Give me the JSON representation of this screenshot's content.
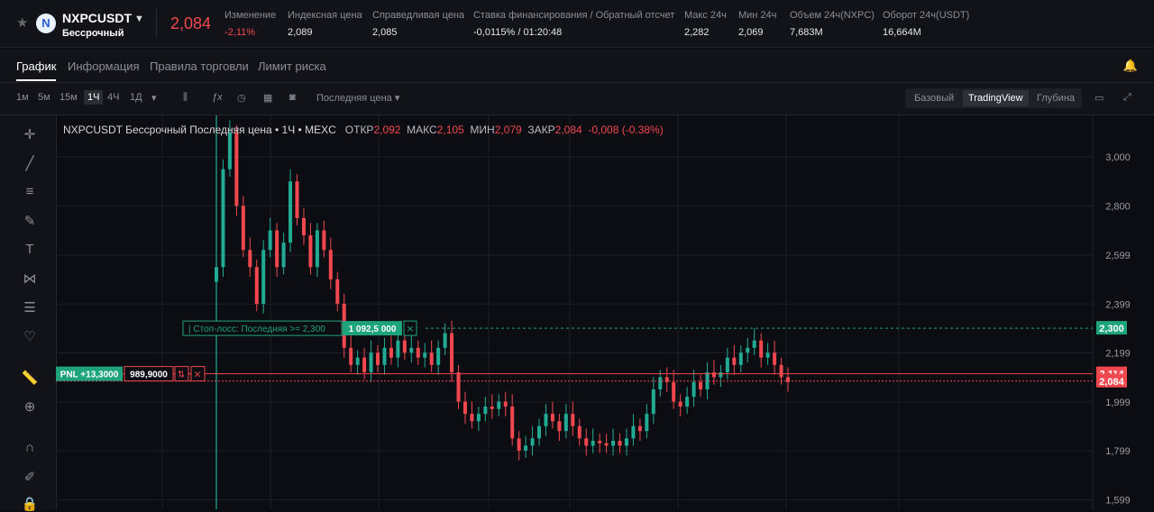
{
  "header": {
    "symbol": "NXPCUSDT",
    "contract": "Бессрочный",
    "last_price": "2,084",
    "stats": [
      {
        "label": "Изменение",
        "value": "-2,11%",
        "red": true
      },
      {
        "label": "Индексная цена",
        "value": "2,089"
      },
      {
        "label": "Справедливая цена",
        "value": "2,085"
      },
      {
        "label": "Ставка финансирования / Обратный отсчет",
        "value": "-0,0115% / 01:20:48"
      },
      {
        "label": "Макс 24ч",
        "value": "2,282"
      },
      {
        "label": "Мин 24ч",
        "value": "2,069"
      },
      {
        "label": "Объем 24ч(NXPC)",
        "value": "7,683M"
      },
      {
        "label": "Оборот 24ч(USDT)",
        "value": "16,664M"
      }
    ]
  },
  "tabs": [
    "График",
    "Информация",
    "Правила торговли",
    "Лимит риска"
  ],
  "toolbar": {
    "intervals": [
      "1м",
      "5м",
      "15м",
      "1Ч",
      "4Ч",
      "1Д"
    ],
    "active_interval": "1Ч",
    "price_source": "Последняя цена",
    "views": [
      "Базовый",
      "TradingView",
      "Глубина"
    ],
    "active_view": "TradingView"
  },
  "legend": {
    "title": "NXPCUSDT Бессрочный Последняя цена • 1Ч • MEXC",
    "open_label": "ОТКР",
    "open": "2,092",
    "high_label": "МАКС",
    "high": "2,105",
    "low_label": "МИН",
    "low": "2,079",
    "close_label": "ЗАКР",
    "close": "2,084",
    "change": "-0,008 (-0.38%)"
  },
  "orders": {
    "stop_loss_label": "Стоп-лосс: Последняя >= 2,300",
    "stop_loss_qty": "1 092,5 000",
    "pnl_label": "PNL +13,3000",
    "position_qty": "989,9000"
  },
  "colors": {
    "up": "#22ab94",
    "down": "#f0484e",
    "bg": "#0c0d12",
    "green_tag": "#1fa37c"
  },
  "chart_data": {
    "type": "candlestick",
    "y_ticks": [
      "3,000",
      "2,800",
      "2,599",
      "2,399",
      "2,199",
      "1,999",
      "1,799",
      "1,599"
    ],
    "ylim": [
      1.56,
      3.17
    ],
    "markers": [
      {
        "label": "2,300",
        "value": 2.3,
        "color": "green"
      },
      {
        "label": "2,114",
        "value": 2.114,
        "color": "red"
      },
      {
        "label": "2,084",
        "value": 2.084,
        "color": "red"
      }
    ],
    "series_close": [
      2.55,
      2.95,
      3.1,
      2.8,
      2.62,
      2.55,
      2.4,
      2.62,
      2.7,
      2.55,
      2.65,
      2.9,
      2.75,
      2.68,
      2.55,
      2.7,
      2.62,
      2.5,
      2.4,
      2.22,
      2.15,
      2.18,
      2.12,
      2.2,
      2.15,
      2.22,
      2.18,
      2.25,
      2.2,
      2.22,
      2.18,
      2.2,
      2.15,
      2.22,
      2.28,
      2.12,
      2.0,
      1.95,
      1.92,
      1.95,
      1.98,
      1.97,
      2.0,
      1.98,
      1.85,
      1.8,
      1.82,
      1.85,
      1.9,
      1.95,
      1.92,
      1.88,
      1.95,
      1.9,
      1.85,
      1.82,
      1.84,
      1.83,
      1.82,
      1.84,
      1.82,
      1.85,
      1.9,
      1.88,
      1.95,
      2.05,
      2.1,
      2.08,
      2.0,
      1.98,
      2.02,
      2.08,
      2.05,
      2.12,
      2.1,
      2.12,
      2.18,
      2.15,
      2.2,
      2.22,
      2.25,
      2.18,
      2.2,
      2.15,
      2.1,
      2.08
    ]
  }
}
